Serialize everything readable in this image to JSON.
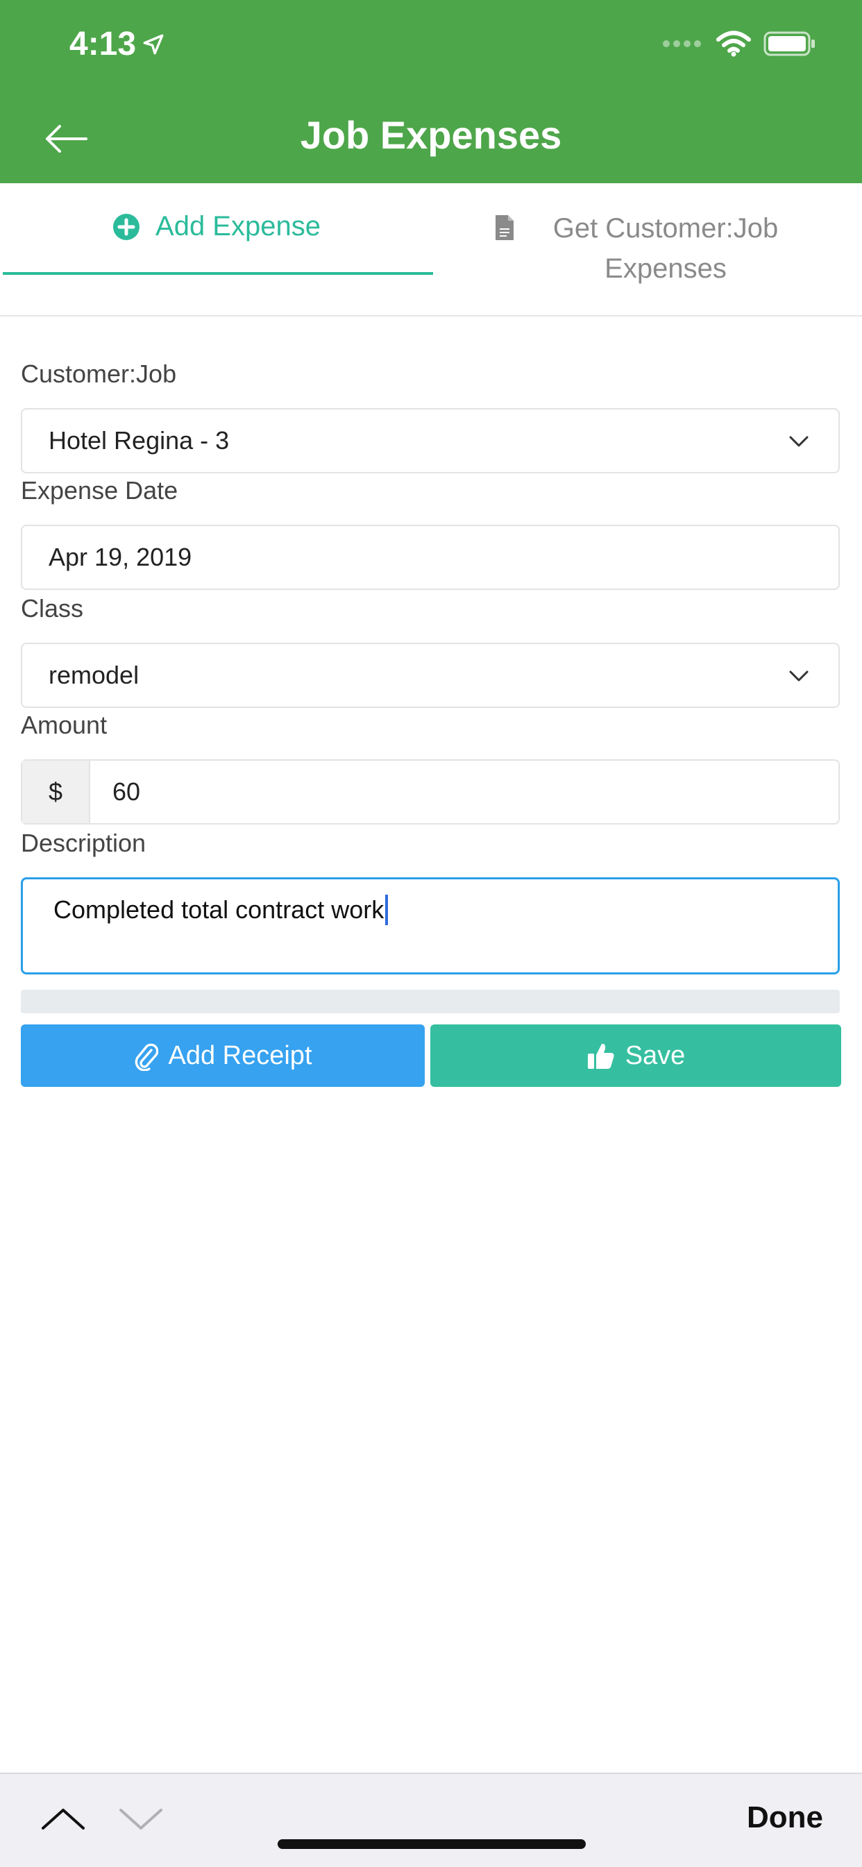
{
  "status_bar": {
    "time": "4:13"
  },
  "header": {
    "title": "Job Expenses"
  },
  "tabs": [
    {
      "label": "Add Expense",
      "active": true
    },
    {
      "label": "Get Customer:Job Expenses",
      "active": false
    }
  ],
  "form": {
    "customer_job": {
      "label": "Customer:Job",
      "value": "Hotel Regina - 3"
    },
    "expense_date": {
      "label": "Expense Date",
      "value": "Apr 19, 2019"
    },
    "class": {
      "label": "Class",
      "value": "remodel"
    },
    "amount": {
      "label": "Amount",
      "prefix": "$",
      "value": "60"
    },
    "description": {
      "label": "Description",
      "value": "Completed total contract work"
    }
  },
  "buttons": {
    "add_receipt": "Add Receipt",
    "save": "Save"
  },
  "keyboard_toolbar": {
    "done": "Done"
  },
  "colors": {
    "header": "#4ea64a",
    "accent": "#2bbb9b",
    "receipt_button": "#36a2f0",
    "save_button": "#35bfa0",
    "focus": "#2a9fe8"
  }
}
